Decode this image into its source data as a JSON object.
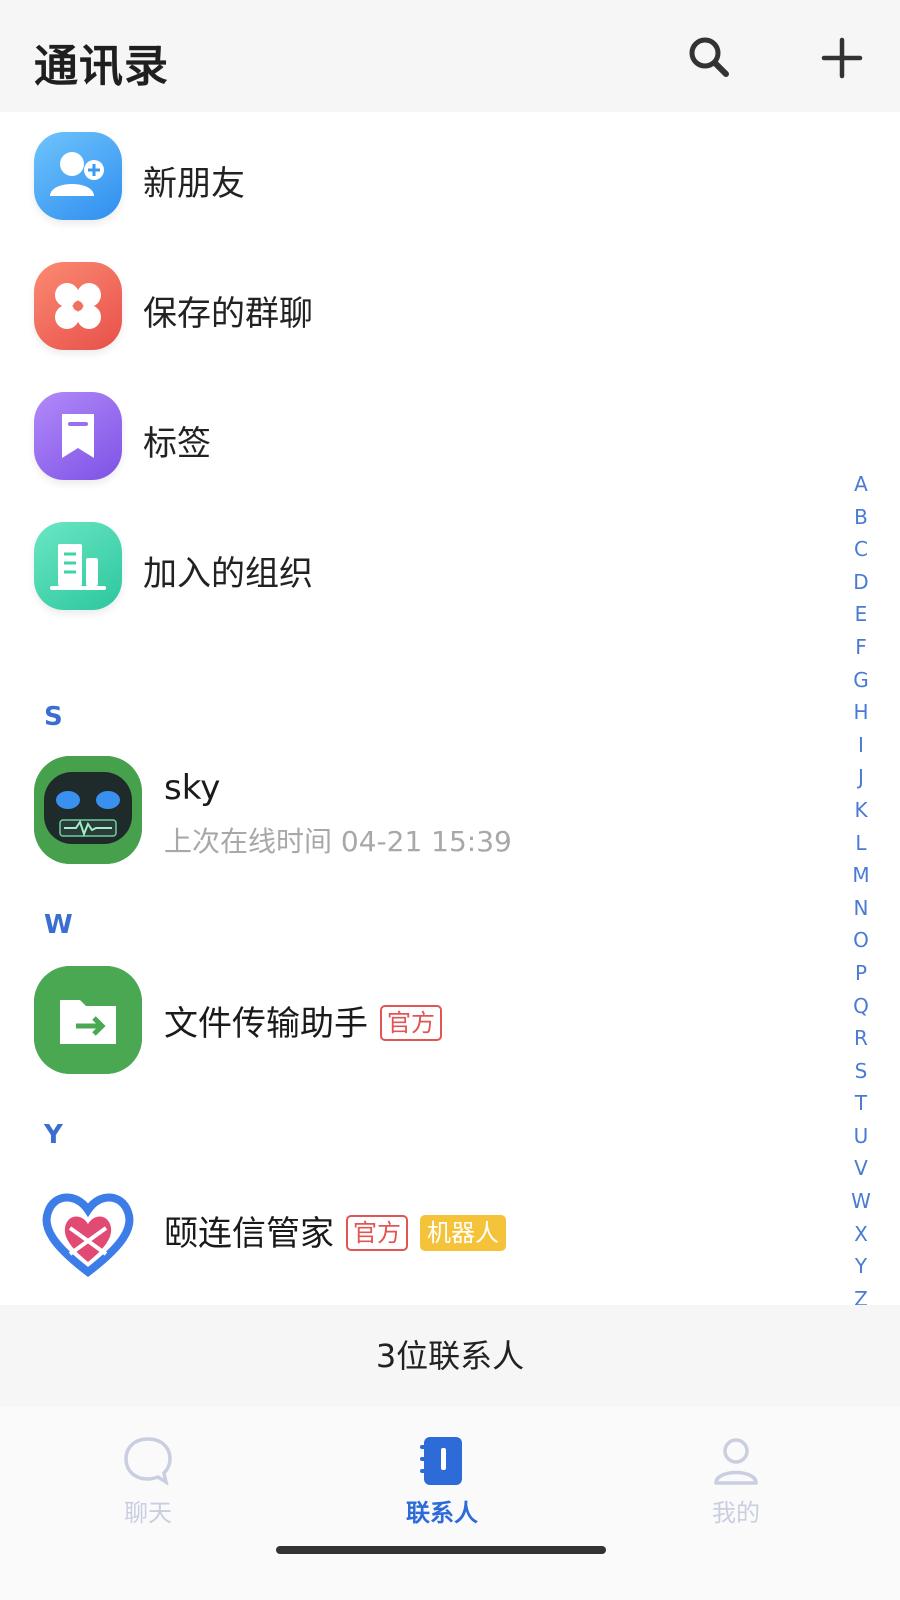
{
  "header": {
    "title": "通讯录",
    "search_icon": "search-icon",
    "add_icon": "plus-icon"
  },
  "entries": [
    {
      "label": "新朋友",
      "icon": "add-user-icon",
      "color": "#49a3f2"
    },
    {
      "label": "保存的群聊",
      "icon": "group-chat-icon",
      "color": "#f0645a"
    },
    {
      "label": "标签",
      "icon": "bookmark-icon",
      "color": "#9a6cf0"
    },
    {
      "label": "加入的组织",
      "icon": "organization-icon",
      "color": "#3fd4a8"
    }
  ],
  "sections": [
    {
      "letter": "S"
    },
    {
      "letter": "W"
    },
    {
      "letter": "Y"
    }
  ],
  "contacts": [
    {
      "name": "sky",
      "subtitle": "上次在线时间 04-21 15:39",
      "icon": "robot-avatar-icon"
    },
    {
      "name": "文件传输助手",
      "tag_official": "官方",
      "icon": "file-transfer-icon"
    },
    {
      "name": "颐连信管家",
      "tag_official": "官方",
      "tag_bot": "机器人",
      "icon": "heart-logo-icon"
    }
  ],
  "alphabet": [
    "A",
    "B",
    "C",
    "D",
    "E",
    "F",
    "G",
    "H",
    "I",
    "J",
    "K",
    "L",
    "M",
    "N",
    "O",
    "P",
    "Q",
    "R",
    "S",
    "T",
    "U",
    "V",
    "W",
    "X",
    "Y",
    "Z",
    "#"
  ],
  "footer": {
    "count_text": "3位联系人"
  },
  "tabs": [
    {
      "label": "聊天",
      "icon": "chat-bubble-icon",
      "active": false
    },
    {
      "label": "联系人",
      "icon": "contacts-book-icon",
      "active": true
    },
    {
      "label": "我的",
      "icon": "profile-icon",
      "active": false
    }
  ],
  "colors": {
    "accent": "#2d6bd8",
    "inactive": "#c9cfe0",
    "official_tag": "#e25555",
    "bot_tag": "#f5c33a"
  }
}
